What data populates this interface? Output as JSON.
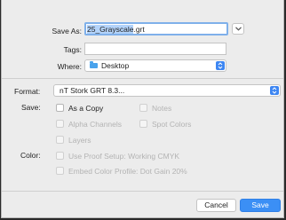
{
  "save_as": {
    "label": "Save As:",
    "value_selected": "25_Grayscale",
    "value_ext": ".grt"
  },
  "tags": {
    "label": "Tags:",
    "value": ""
  },
  "where": {
    "label": "Where:",
    "value": "Desktop"
  },
  "format": {
    "label": "Format:",
    "value": "nT Stork GRT 8.3..."
  },
  "save_options": {
    "label": "Save:",
    "as_a_copy": "As a Copy",
    "notes": "Notes",
    "alpha_channels": "Alpha Channels",
    "spot_colors": "Spot Colors",
    "layers": "Layers"
  },
  "color_options": {
    "label": "Color:",
    "use_proof_setup": "Use Proof Setup:  Working CMYK",
    "embed_color_profile": "Embed Color Profile:  Dot Gain 20%"
  },
  "buttons": {
    "cancel": "Cancel",
    "save": "Save"
  },
  "colors": {
    "accent": "#3b8ff5",
    "focus_ring": "#7fb0ea",
    "folder": "#4aa3ec"
  },
  "icons": {
    "expand": "chevron-down-icon",
    "where": "folder-icon",
    "popup": "updown-arrows-icon"
  }
}
